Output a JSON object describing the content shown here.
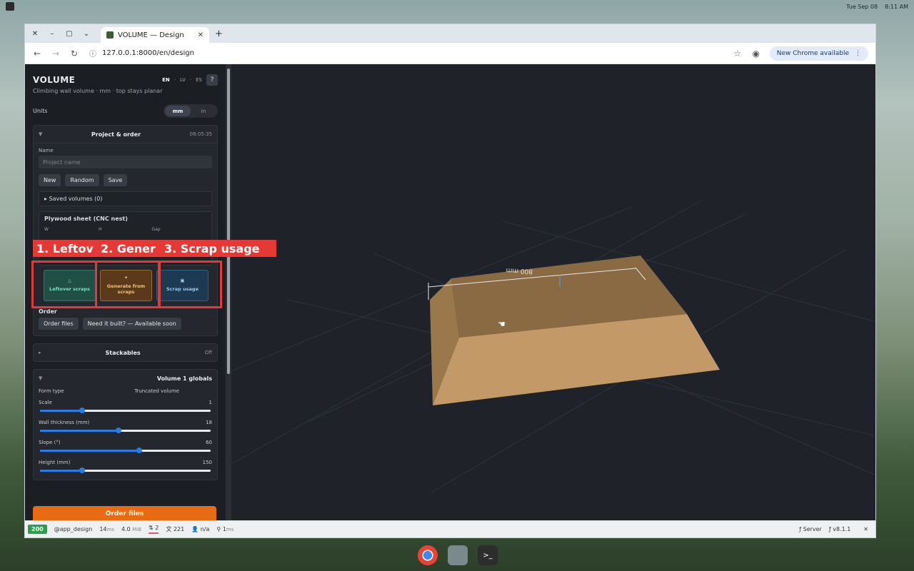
{
  "desktop": {
    "date": "Tue Sep 08",
    "time": "8:11 AM"
  },
  "browser": {
    "tab_title": "VOLUME — Design",
    "url": "127.0.0.1:8000/en/design",
    "update_label": "New Chrome available"
  },
  "app": {
    "title": "VOLUME",
    "subtitle": "Climbing wall volume · mm · top stays planar",
    "languages": [
      "EN",
      "LV",
      "ES"
    ],
    "help": "?",
    "units_label": "Units",
    "units": [
      "mm",
      "in"
    ]
  },
  "project": {
    "title": "Project & order",
    "time": "08:05:35",
    "name_label": "Name",
    "name_placeholder": "Project name",
    "buttons": [
      "New",
      "Random",
      "Save"
    ],
    "saved_label": "Saved volumes (0)",
    "plywood_title": "Plywood sheet (CNC nest)",
    "plywood_dims": [
      "W",
      "H",
      "Gap"
    ],
    "cards": [
      "Leftover scraps",
      "Generate from scraps",
      "Scrap usage"
    ],
    "order_title": "Order",
    "order_buttons": [
      "Order files",
      "Need it built? — Available soon"
    ]
  },
  "stackables": {
    "title": "Stackables",
    "state": "Off"
  },
  "globals": {
    "title": "Volume 1 globals",
    "form_type_label": "Form type",
    "form_type_value": "Truncated volume",
    "sliders": [
      {
        "label": "Scale",
        "value": "1",
        "fraction": 0.25
      },
      {
        "label": "Wall thickness (mm)",
        "value": "18",
        "fraction": 0.46
      },
      {
        "label": "Slope (°)",
        "value": "60",
        "fraction": 0.58
      },
      {
        "label": "Height (mm)",
        "value": "150",
        "fraction": 0.25
      }
    ]
  },
  "order_cta": "Order files",
  "viewport": {
    "dimension_label": "800 mm",
    "model_color": "#8a6a43"
  },
  "statusbar": {
    "code": "200",
    "route": "@app_design",
    "time": "14",
    "time_unit": "ms",
    "memory": "4.0",
    "memory_unit": "MiB",
    "requests": "2",
    "translations": "221",
    "user": "n/a",
    "events": "1",
    "events_unit": "ms",
    "server": "Server",
    "version": "v8.1.1"
  },
  "annotations": [
    "1. Leftov",
    "2. Gener",
    "3. Scrap usage"
  ]
}
